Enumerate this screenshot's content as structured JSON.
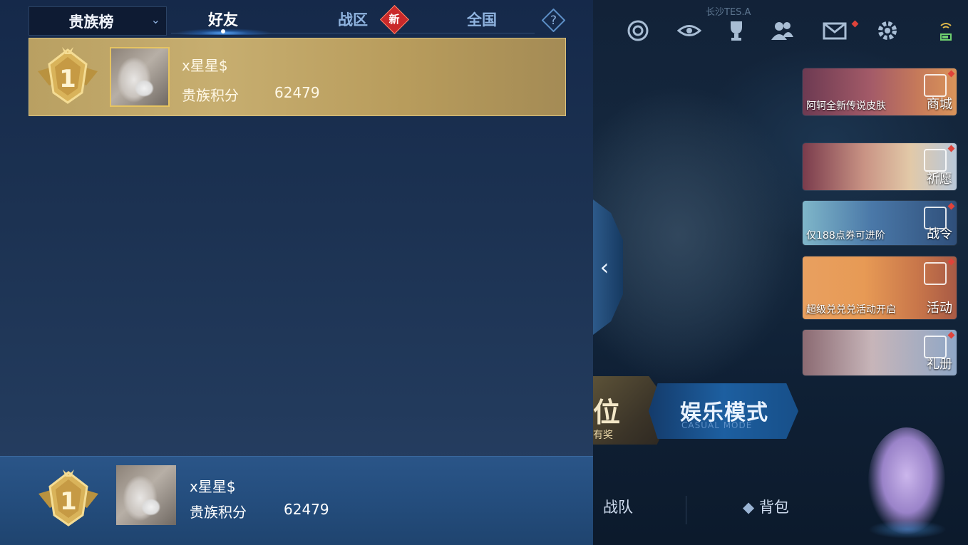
{
  "leaderboard": {
    "board_selector": {
      "label": "贵族榜",
      "icon": "chevron-down-icon"
    },
    "tabs": [
      {
        "label": "好友",
        "active": true
      },
      {
        "label": "战区",
        "badge": "新"
      },
      {
        "label": "全国"
      }
    ],
    "help_icon": "question-icon",
    "entries": [
      {
        "rank": "1",
        "name": "x星星$",
        "score_label": "贵族积分",
        "score": "62479"
      }
    ],
    "self": {
      "rank": "1",
      "name": "x星星$",
      "score_label": "贵族积分",
      "score": "62479"
    }
  },
  "game_screen": {
    "server_label": "长沙TES.A",
    "top_icons": [
      "target-icon",
      "eye-icon",
      "trophy-icon",
      "friends-icon",
      "mail-icon",
      "settings-icon",
      "wifi-battery-icon"
    ],
    "promos": [
      {
        "caption": "阿轲全新传说皮肤",
        "tag": "商城"
      },
      {
        "caption": "",
        "tag": "祈愿"
      },
      {
        "caption": "仅188点券可进阶",
        "tag": "战令"
      },
      {
        "caption": "超级兑兑兑活动开启",
        "tag": "活动"
      },
      {
        "caption": "",
        "tag": "礼册"
      }
    ],
    "modes": {
      "ranked": {
        "label": "位",
        "sub": "有奖"
      },
      "casual": {
        "label": "娱乐模式",
        "sub": "CASUAL MODE"
      }
    },
    "bottom_tabs": {
      "team": "战队",
      "bag": "背包"
    }
  },
  "colors": {
    "accent": "#5aaaff",
    "gold": "#c7ae70",
    "new_badge": "#c9292a"
  }
}
